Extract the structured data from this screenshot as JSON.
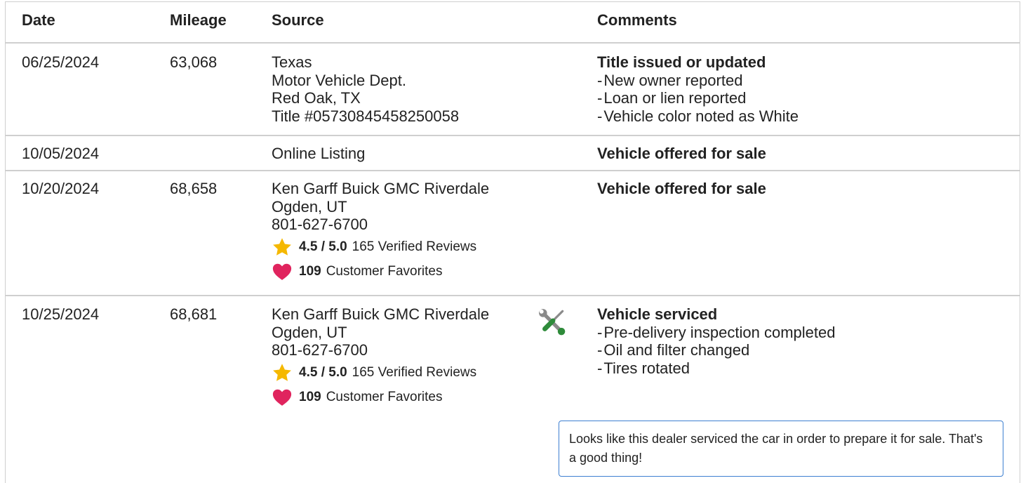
{
  "columns": {
    "date": "Date",
    "mileage": "Mileage",
    "source": "Source",
    "comments": "Comments"
  },
  "rows": [
    {
      "date": "06/25/2024",
      "mileage": "63,068",
      "source": [
        "Texas",
        "Motor Vehicle Dept.",
        "Red Oak, TX",
        "Title #05730845458250058"
      ],
      "comment_title": "Title issued or updated",
      "comment_items": [
        "New owner reported",
        "Loan or lien reported",
        "Vehicle color noted as White"
      ]
    },
    {
      "date": "10/05/2024",
      "mileage": "",
      "source": [
        "Online Listing"
      ],
      "comment_title": "Vehicle offered for sale",
      "comment_items": []
    },
    {
      "date": "10/20/2024",
      "mileage": "68,658",
      "source": [
        "Ken Garff Buick GMC Riverdale",
        "Ogden, UT",
        "801-627-6700"
      ],
      "rating": {
        "score": "4.5 / 5.0",
        "reviews": "165 Verified Reviews"
      },
      "favorites": {
        "count": "109",
        "label": "Customer Favorites"
      },
      "comment_title": "Vehicle offered for sale",
      "comment_items": []
    },
    {
      "date": "10/25/2024",
      "mileage": "68,681",
      "source": [
        "Ken Garff Buick GMC Riverdale",
        "Ogden, UT",
        "801-627-6700"
      ],
      "rating": {
        "score": "4.5 / 5.0",
        "reviews": "165 Verified Reviews"
      },
      "favorites": {
        "count": "109",
        "label": "Customer Favorites"
      },
      "icon": "service-tools-icon",
      "comment_title": "Vehicle serviced",
      "comment_items": [
        "Pre-delivery inspection completed",
        "Oil and filter changed",
        "Tires rotated"
      ]
    }
  ],
  "tooltip": {
    "text": "Looks like this dealer serviced the car in order to prepare it for sale. That's a good thing!"
  },
  "icons": {
    "rating": "star-icon",
    "favorites": "heart-icon"
  },
  "colors": {
    "star": "#f5b800",
    "heart": "#e0245e",
    "tool_handle": "#2e8b3a",
    "tool_metal": "#8a8a8a",
    "tooltip_border": "#3d7fd1",
    "divider": "#cfcfcf"
  }
}
